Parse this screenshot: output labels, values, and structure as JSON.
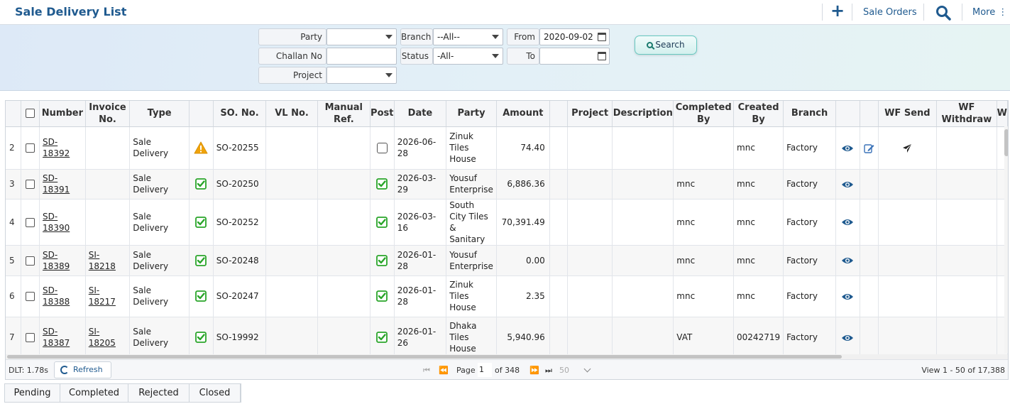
{
  "header": {
    "title": "Sale Delivery List",
    "add_icon": "plus-icon",
    "sale_orders_label": "Sale Orders",
    "search_icon": "search-icon",
    "more_label": "More ⋮"
  },
  "filters": {
    "party_label": "Party",
    "party_value": "",
    "branch_label": "Branch",
    "branch_value": "--All--",
    "from_label": "From",
    "from_value": "2020-09-02",
    "challan_label": "Challan No",
    "challan_value": "",
    "status_label": "Status",
    "status_value": "-All-",
    "to_label": "To",
    "to_value": "",
    "project_label": "Project",
    "project_value": "",
    "search_button": "Search"
  },
  "grid": {
    "columns": [
      "",
      "",
      "Number",
      "Invoice No.",
      "Type",
      "",
      "SO. No.",
      "VL No.",
      "Manual Ref.",
      "Post",
      "Date",
      "Party",
      "Amount",
      "",
      "Project",
      "Description",
      "Completed By",
      "Created By",
      "Branch",
      "",
      "",
      "WF Send",
      "WF Withdraw",
      "W"
    ],
    "rows": [
      {
        "rn": "2",
        "number": "SD-18392",
        "invoice": "",
        "type": "Sale Delivery",
        "status_icon": "warning-icon",
        "so": "SO-20255",
        "vl": "",
        "manual": "",
        "posted": false,
        "date": "2026-06-28",
        "party": "Zinuk Tiles House",
        "amount": "74.40",
        "project": "",
        "description": "",
        "completed_by": "",
        "created_by": "mnc",
        "branch": "Factory",
        "editable": true
      },
      {
        "rn": "3",
        "number": "SD-18391",
        "invoice": "",
        "type": "Sale Delivery",
        "status_icon": "check-icon",
        "so": "SO-20250",
        "vl": "",
        "manual": "",
        "posted": true,
        "date": "2026-03-29",
        "party": "Yousuf Enterprise",
        "amount": "6,886.36",
        "project": "",
        "description": "",
        "completed_by": "mnc",
        "created_by": "mnc",
        "branch": "Factory",
        "editable": false
      },
      {
        "rn": "4",
        "number": "SD-18390",
        "invoice": "",
        "type": "Sale Delivery",
        "status_icon": "check-icon",
        "so": "SO-20252",
        "vl": "",
        "manual": "",
        "posted": true,
        "date": "2026-03-16",
        "party": "South City Tiles & Sanitary",
        "amount": "70,391.49",
        "project": "",
        "description": "",
        "completed_by": "mnc",
        "created_by": "mnc",
        "branch": "Factory",
        "editable": false
      },
      {
        "rn": "5",
        "number": "SD-18389",
        "invoice": "SI-18218",
        "type": "Sale Delivery",
        "status_icon": "check-icon",
        "so": "SO-20248",
        "vl": "",
        "manual": "",
        "posted": true,
        "date": "2026-01-28",
        "party": "Yousuf Enterprise",
        "amount": "0.00",
        "project": "",
        "description": "",
        "completed_by": "mnc",
        "created_by": "mnc",
        "branch": "Factory",
        "editable": false
      },
      {
        "rn": "6",
        "number": "SD-18388",
        "invoice": "SI-18217",
        "type": "Sale Delivery",
        "status_icon": "check-icon",
        "so": "SO-20247",
        "vl": "",
        "manual": "",
        "posted": true,
        "date": "2026-01-28",
        "party": "Zinuk Tiles House",
        "amount": "2.35",
        "project": "",
        "description": "",
        "completed_by": "mnc",
        "created_by": "mnc",
        "branch": "Factory",
        "editable": false
      },
      {
        "rn": "7",
        "number": "SD-18387",
        "invoice": "SI-18205",
        "type": "Sale Delivery",
        "status_icon": "check-icon",
        "so": "SO-19992",
        "vl": "",
        "manual": "",
        "posted": true,
        "date": "2026-01-26",
        "party": "Dhaka Tiles House",
        "amount": "5,940.96",
        "project": "",
        "description": "",
        "completed_by": "VAT",
        "created_by": "00242719",
        "branch": "Factory",
        "editable": false
      }
    ]
  },
  "pager": {
    "dlt": "DLT: 1.78s",
    "refresh_label": "Refresh",
    "page_label": "Page",
    "page_value": "1",
    "of_pages": "of 348",
    "page_size": "50",
    "view_info": "View 1 - 50 of 17,388"
  },
  "tabs": [
    "Pending",
    "Completed",
    "Rejected",
    "Closed"
  ],
  "colors": {
    "brand": "#1f5a8f",
    "ok_green": "#2aa52a",
    "warn_orange": "#f0a30a"
  }
}
